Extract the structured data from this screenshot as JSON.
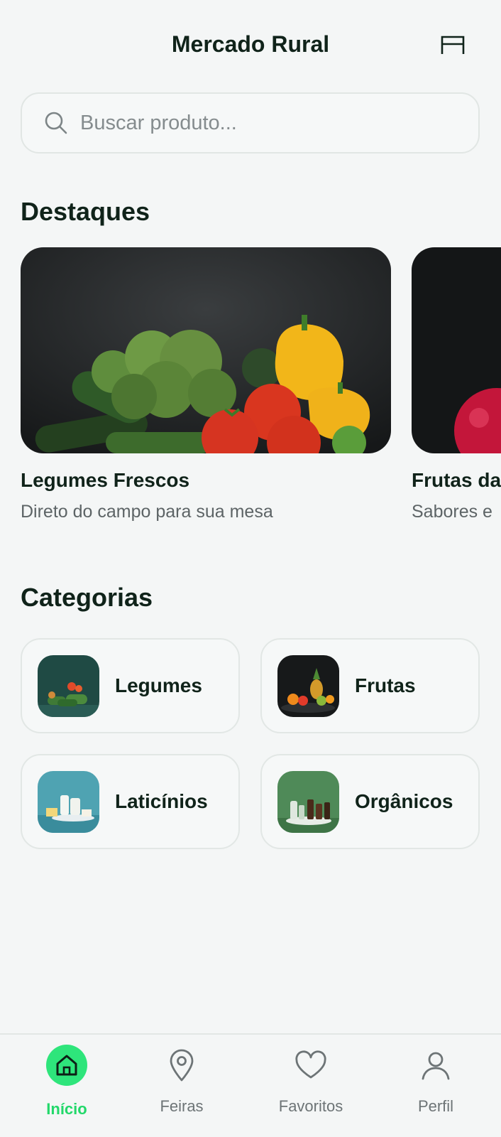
{
  "header": {
    "title": "Mercado Rural"
  },
  "search": {
    "placeholder": "Buscar produto..."
  },
  "featured": {
    "title": "Destaques",
    "cards": [
      {
        "title": "Legumes Frescos",
        "subtitle": "Direto do campo para sua mesa"
      },
      {
        "title": "Frutas da",
        "subtitle": "Sabores e"
      }
    ]
  },
  "categories": {
    "title": "Categorias",
    "items": [
      {
        "label": "Legumes"
      },
      {
        "label": "Frutas"
      },
      {
        "label": "Laticínios"
      },
      {
        "label": "Orgânicos"
      }
    ]
  },
  "nav": {
    "items": [
      {
        "label": "Início",
        "icon": "home-icon",
        "active": true
      },
      {
        "label": "Feiras",
        "icon": "map-pin-icon"
      },
      {
        "label": "Favoritos",
        "icon": "heart-icon"
      },
      {
        "label": "Perfil",
        "icon": "user-icon"
      }
    ]
  },
  "colors": {
    "accent": "#2ee57b",
    "text": "#10231a",
    "background": "#f4f6f6"
  }
}
